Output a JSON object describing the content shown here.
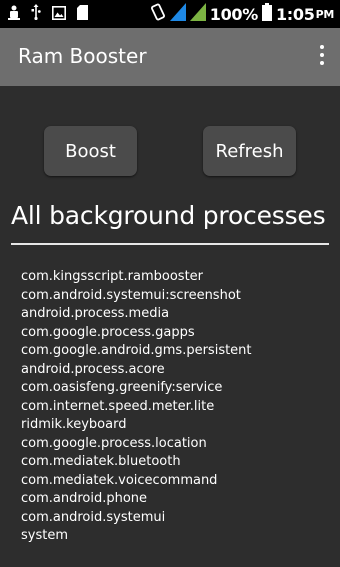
{
  "status_bar": {
    "battery_percent": "100%",
    "time": "1:05",
    "time_suffix": "PM",
    "icons": [
      "notification-icon",
      "usb-icon",
      "image-icon",
      "sd-card-icon",
      "vibrate-icon",
      "signal-icon-1",
      "signal-icon-2",
      "battery-icon"
    ]
  },
  "app_bar": {
    "title": "Ram Booster",
    "menu_icon": "overflow-menu-icon"
  },
  "actions": {
    "boost_label": "Boost",
    "refresh_label": "Refresh"
  },
  "section": {
    "title": "All background processes"
  },
  "processes": [
    "com.kingsscript.rambooster",
    "com.android.systemui:screenshot",
    "android.process.media",
    "com.google.process.gapps",
    "com.google.android.gms.persistent",
    "android.process.acore",
    "com.oasisfeng.greenify:service",
    "com.internet.speed.meter.lite",
    "ridmik.keyboard",
    "com.google.process.location",
    "com.mediatek.bluetooth",
    "com.mediatek.voicecommand",
    "com.android.phone",
    "com.android.systemui",
    "system"
  ],
  "colors": {
    "background": "#2d2d2d",
    "app_bar": "#6e6e6e",
    "button": "#4b4b4b",
    "signal_primary": "#1e88e5",
    "signal_secondary": "#7cb342"
  }
}
